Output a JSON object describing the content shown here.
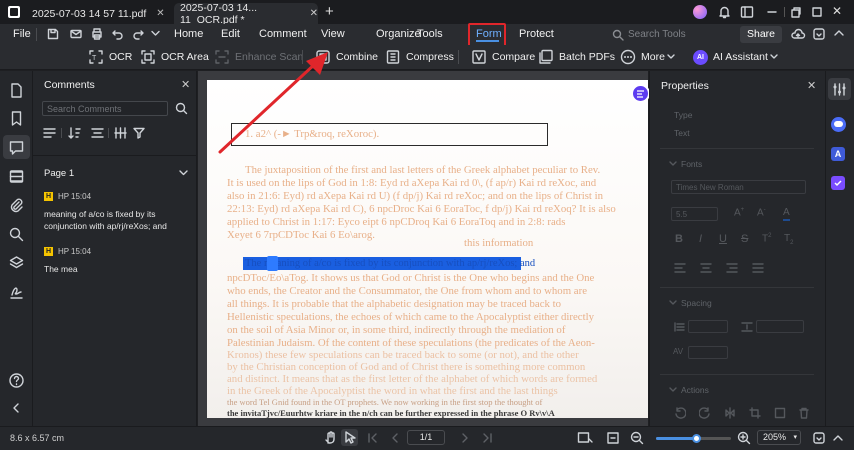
{
  "tabs": [
    {
      "label": "2025-07-03 14 57 11.pdf"
    },
    {
      "label": "2025-07-03 14... 11_OCR.pdf *"
    }
  ],
  "menu": {
    "file": "File",
    "items": [
      "Home",
      "Edit",
      "Comment",
      "View",
      "Organize",
      "Tools",
      "Form",
      "Protect"
    ],
    "active": "Tools",
    "search_placeholder": "Search Tools",
    "share": "Share"
  },
  "toolbar": {
    "ocr": "OCR",
    "ocr_area": "OCR Area",
    "enhance_scan": "Enhance Scan",
    "combine": "Combine",
    "compress": "Compress",
    "compare": "Compare",
    "batch_pdfs": "Batch PDFs",
    "more": "More",
    "ai_assistant": "AI Assistant"
  },
  "comments": {
    "title": "Comments",
    "search_placeholder": "Search Comments",
    "page_label": "Page 1",
    "items": [
      {
        "author": "HP",
        "time": "15:04",
        "text_line1": "meaning of a/co is fixed by its",
        "text_line2": "conjunction with ap/rj/reXos; and"
      },
      {
        "author": "HP",
        "time": "15:04",
        "text_line1": "The mea",
        "text_line2": ""
      }
    ]
  },
  "document": {
    "heading": "1. a2^ (-► Trp&roq, reXoroc).",
    "lines": [
      "The juxtaposition of the first and last letters of the Greek alphabet peculiar to Rev.",
      "It is used on the lips of God in 1:8: Eyd rd aXepa Kai rd 0\\, (f ap/r) Kai rd reXoc, and",
      "also in 21:6: Eyd) rd aXepa Kai rd U) (f dp/j) Kai rd reXoc; and on the lips of Christ in",
      "22:13: Eyd) rd aXepa Kai rd C), 6 npcDroc Kai 6 EoraToc, f dp/j) Kai rd reXoq? It is also",
      "applied to Christ in 1:17: Eyco eipt 6 npCDroq Kai 6 EoraToq and in 2:8: rads",
      "Xeyet 6 7rpCDToc Kai 6 Eo\\arog.",
      "this information",
      "The meaning of a/co is fixed by its conjunction with ap/rj/reXos; and",
      "npcDToc/Eo\\aTog. It shows us that God or Christ is the One who begins and the One",
      "who ends, the Creator and the Consummator, the One from whom and to whom are",
      "all things. It is probable that the alphabetic designation may be traced back to",
      "Hellenistic speculations, the echoes of which came to the Apocalyptist either directly",
      "on the soil of Asia Minor or, in some third, indirectly through the mediation of",
      "Palestinian Judaism. Of the content of these speculations (the predicates of the Aeon-",
      "Kronos) these few speculations can be traced back to some (or not), and the other",
      "by the Christian conception of God and of Christ there is something more common",
      "and distinct. It means that as the first letter of the alphabet of which words are formed",
      "in the Greek of the Apocalyptist the word in what the first and the last things",
      "the word Tel Gnid found in the OT prophets. We now working in the first stop the thought of",
      "the invitaTjvc/Euurhtw kriare in the n/ch can be further expressed in the phrase O Rv\\v\\A"
    ]
  },
  "properties": {
    "title": "Properties",
    "type_label": "Type",
    "text_label": "Text",
    "fonts_label": "Fonts",
    "font_value": "Times New Roman",
    "size_value": "5.5",
    "spacing_label": "Spacing",
    "actions_label": "Actions"
  },
  "status": {
    "dimensions": "8.6 x 6.57 cm",
    "page_indicator": "1/1",
    "zoom": "205%",
    "zoom_level": 0.52
  },
  "colors": {
    "accent_blue": "#4a90e2",
    "highlight_red": "#e0262b",
    "selection_blue": "#1a5fe0",
    "ai_purple": "#6b4cff"
  }
}
